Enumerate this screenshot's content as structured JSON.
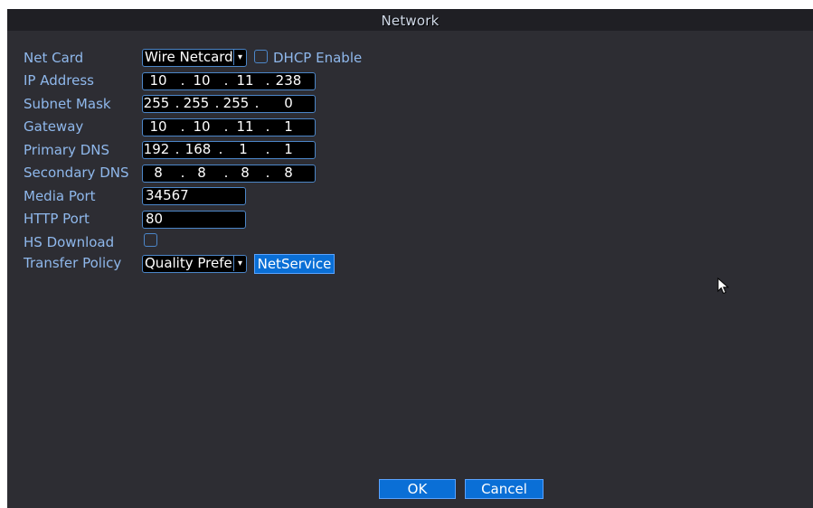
{
  "window": {
    "title": "Network"
  },
  "fields": {
    "net_card": {
      "label": "Net Card",
      "value": "Wire Netcard"
    },
    "dhcp": {
      "label": "DHCP Enable",
      "checked": false
    },
    "ip_address": {
      "label": "IP Address",
      "octets": [
        "10",
        "10",
        "11",
        "238"
      ]
    },
    "subnet_mask": {
      "label": "Subnet Mask",
      "octets": [
        "255",
        "255",
        "255",
        "0"
      ]
    },
    "gateway": {
      "label": "Gateway",
      "octets": [
        "10",
        "10",
        "11",
        "1"
      ]
    },
    "primary_dns": {
      "label": "Primary DNS",
      "octets": [
        "192",
        "168",
        "1",
        "1"
      ]
    },
    "secondary_dns": {
      "label": "Secondary DNS",
      "octets": [
        "8",
        "8",
        "8",
        "8"
      ]
    },
    "media_port": {
      "label": "Media Port",
      "value": "34567"
    },
    "http_port": {
      "label": "HTTP Port",
      "value": "80"
    },
    "hs_download": {
      "label": "HS Download",
      "checked": false
    },
    "transfer_policy": {
      "label": "Transfer Policy",
      "value": "Quality Prefe"
    }
  },
  "buttons": {
    "netservice": "NetService",
    "ok": "OK",
    "cancel": "Cancel"
  },
  "colors": {
    "label": "#8fb8ec",
    "border": "#4c86c8",
    "button": "#0a6fd6",
    "panel": "#2d2d33"
  }
}
